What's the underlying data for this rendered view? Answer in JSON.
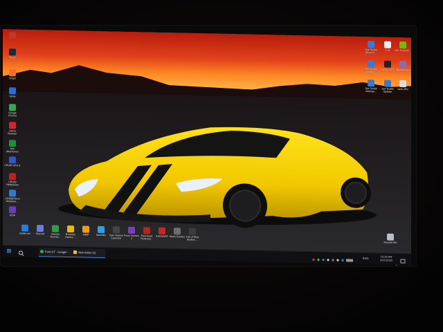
{
  "colors": {
    "sky_top": "#c22410",
    "sky_glow": "#ff7a1a",
    "car_yellow": "#f5d000",
    "taskbar": "#101014",
    "accent": "#3a86d6"
  },
  "desktop_left_icons": [
    {
      "label": "",
      "icon": "app-icon",
      "color": "#c0392b"
    },
    {
      "label": "Steam",
      "icon": "steam-icon",
      "color": "#1b2838"
    },
    {
      "label": "Origin",
      "icon": "origin-icon",
      "color": "#f56c2d"
    },
    {
      "label": "Uplay",
      "icon": "uplay-icon",
      "color": "#2b6cd4"
    },
    {
      "label": "Google Chrome",
      "icon": "chrome-icon",
      "color": "#34a853"
    },
    {
      "label": "Opera Browser",
      "icon": "opera-icon",
      "color": "#d0262e"
    },
    {
      "label": "MSI Afterburner",
      "icon": "msi-afterburner-icon",
      "color": "#1f8f3a"
    },
    {
      "label": "CPUID CPU-Z",
      "icon": "cpuz-icon",
      "color": "#2f57c7"
    },
    {
      "label": "CPUID HWMonitor",
      "icon": "hwmonitor-icon",
      "color": "#c01f1f"
    },
    {
      "label": "CINEBENCH Windows ...",
      "icon": "cinebench-icon",
      "color": "#2e7bd1"
    },
    {
      "label": "AIDA",
      "icon": "aida-icon",
      "color": "#6a3cb5"
    }
  ],
  "desktop_bottom_icons": [
    {
      "label": "Battle.net",
      "icon": "battlenet-icon",
      "color": "#2a7ad8"
    },
    {
      "label": "Discord",
      "icon": "discord-icon",
      "color": "#6f7bd9"
    },
    {
      "label": "Internet Downlo...",
      "icon": "idm-icon",
      "color": "#2f9e44"
    },
    {
      "label": "Rockstar Games ...",
      "icon": "rockstar-icon",
      "color": "#e5b812"
    },
    {
      "label": "AIMP",
      "icon": "aimp-icon",
      "color": "#f39c12"
    },
    {
      "label": "Speedify",
      "icon": "speedify-icon",
      "color": "#29a3e8"
    },
    {
      "label": "Epic Games Launcher",
      "icon": "epic-games-icon",
      "color": "#444444"
    },
    {
      "label": "Forza Horizon 4",
      "icon": "forza-icon",
      "color": "#7a3cc2"
    },
    {
      "label": "Red Dead Redempt...",
      "icon": "rdr-icon",
      "color": "#b3261e"
    },
    {
      "label": "ASUSWRT",
      "icon": "asus-icon",
      "color": "#c62828"
    },
    {
      "label": "Metro Exodus",
      "icon": "metro-icon",
      "color": "#6d6d6d"
    },
    {
      "label": "Call of Duty Modern ...",
      "icon": "cod-icon",
      "color": "#3c3c3c"
    }
  ],
  "desktop_right_icons": [
    {
      "label": "Sys Toolkit Driver In...",
      "icon": "driver-icon",
      "color": "#3a78d6"
    },
    {
      "label": "1.txt",
      "icon": "text-file-icon",
      "color": "#eeeeee"
    },
    {
      "label": "442.19-deskt...",
      "icon": "nvidia-icon",
      "color": "#76b900"
    },
    {
      "label": "Sys Toolkit Monitor...",
      "icon": "monitor-icon",
      "color": "#3a78d6"
    },
    {
      "label": "Capture.JPG",
      "icon": "image-file-icon",
      "color": "#222222"
    },
    {
      "label": "dfschedl.jpg",
      "icon": "image-file-icon",
      "color": "#8a6bb0"
    },
    {
      "label": "Sys Toolkit Settings...",
      "icon": "settings-icon",
      "color": "#3a78d6"
    },
    {
      "label": "Sys Toolkit Updater",
      "icon": "updater-icon",
      "color": "#3a78d6"
    },
    {
      "label": "wpm.JPG",
      "icon": "image-file-icon",
      "color": "#dddddd"
    }
  ],
  "recycle_bin": {
    "label": "Recycle Bin",
    "icon": "recycle-bin-icon"
  },
  "taskbar": {
    "tasks": [
      {
        "label": "Ford GT - Google ...",
        "icon": "chrome-icon",
        "color": "#34a853"
      },
      {
        "label": "New folder (2)",
        "icon": "folder-icon",
        "color": "#f2c14e"
      }
    ],
    "tray_lang": "ENG",
    "time": "10:28 AM",
    "date": "3/21/2020"
  }
}
